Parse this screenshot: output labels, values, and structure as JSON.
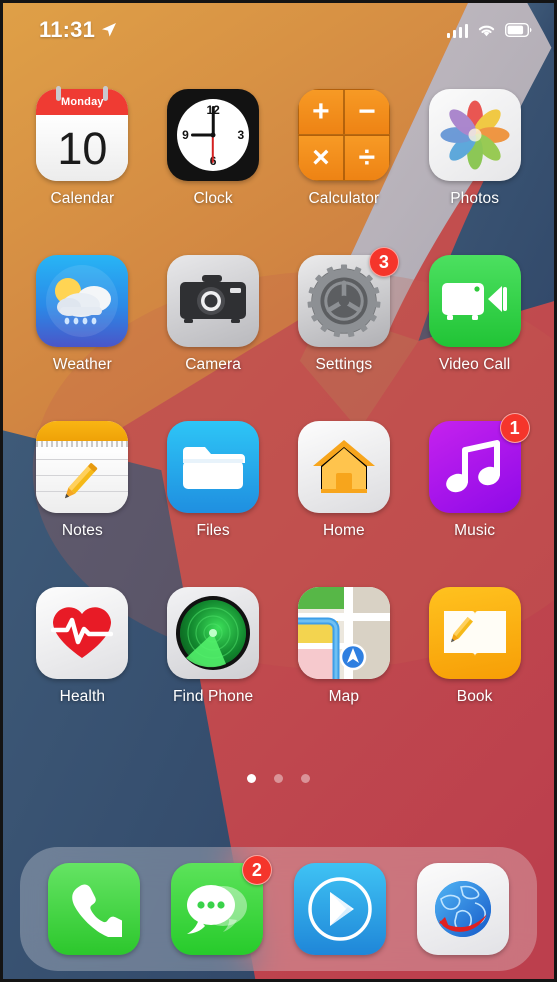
{
  "status_bar": {
    "time": "11:31",
    "location_icon": "location-arrow-icon",
    "signal_icon": "cellular-signal-icon",
    "wifi_icon": "wifi-icon",
    "battery_icon": "battery-icon"
  },
  "home_screen": {
    "apps": [
      {
        "name": "Calendar",
        "label": "Calendar",
        "icon": "calendar-icon",
        "badge": null,
        "calendar_weekday": "Monday",
        "calendar_date": "10"
      },
      {
        "name": "Clock",
        "label": "Clock",
        "icon": "clock-icon",
        "badge": null,
        "clock_numerals": [
          "12",
          "3",
          "6",
          "9"
        ]
      },
      {
        "name": "Calculator",
        "label": "Calculator",
        "icon": "calculator-icon",
        "badge": null,
        "calculator_ops": [
          "+",
          "−",
          "×",
          "÷"
        ]
      },
      {
        "name": "Photos",
        "label": "Photos",
        "icon": "photos-icon",
        "badge": null
      },
      {
        "name": "Weather",
        "label": "Weather",
        "icon": "weather-icon",
        "badge": null
      },
      {
        "name": "Camera",
        "label": "Camera",
        "icon": "camera-icon",
        "badge": null
      },
      {
        "name": "Settings",
        "label": "Settings",
        "icon": "settings-gear-icon",
        "badge": "3"
      },
      {
        "name": "Video Call",
        "label": "Video Call",
        "icon": "video-camera-icon",
        "badge": null
      },
      {
        "name": "Notes",
        "label": "Notes",
        "icon": "notes-icon",
        "badge": null
      },
      {
        "name": "Files",
        "label": "Files",
        "icon": "folder-icon",
        "badge": null
      },
      {
        "name": "Home",
        "label": "Home",
        "icon": "house-icon",
        "badge": null
      },
      {
        "name": "Music",
        "label": "Music",
        "icon": "music-note-icon",
        "badge": "1"
      },
      {
        "name": "Health",
        "label": "Health",
        "icon": "heart-pulse-icon",
        "badge": null
      },
      {
        "name": "Find Phone",
        "label": "Find Phone",
        "icon": "radar-icon",
        "badge": null
      },
      {
        "name": "Map",
        "label": "Map",
        "icon": "map-icon",
        "badge": null
      },
      {
        "name": "Book",
        "label": "Book",
        "icon": "open-book-icon",
        "badge": null
      }
    ],
    "page_dots": {
      "total": 3,
      "active_index": 0
    }
  },
  "dock": {
    "apps": [
      {
        "name": "Phone",
        "icon": "phone-handset-icon",
        "badge": null
      },
      {
        "name": "Messages",
        "icon": "chat-bubble-icon",
        "badge": "2"
      },
      {
        "name": "Play Store",
        "icon": "play-store-icon",
        "badge": null
      },
      {
        "name": "Browser",
        "icon": "globe-browser-icon",
        "badge": null
      }
    ]
  },
  "wallpaper": {
    "colors": {
      "orange": "#d9943f",
      "gray_band": "#b9bcc4",
      "slate_blue": "#3c5873",
      "red": "#c04450",
      "deep_blue": "#3d5572"
    }
  },
  "theme": {
    "badge_color": "#f5352b",
    "label_color": "#ffffff"
  }
}
